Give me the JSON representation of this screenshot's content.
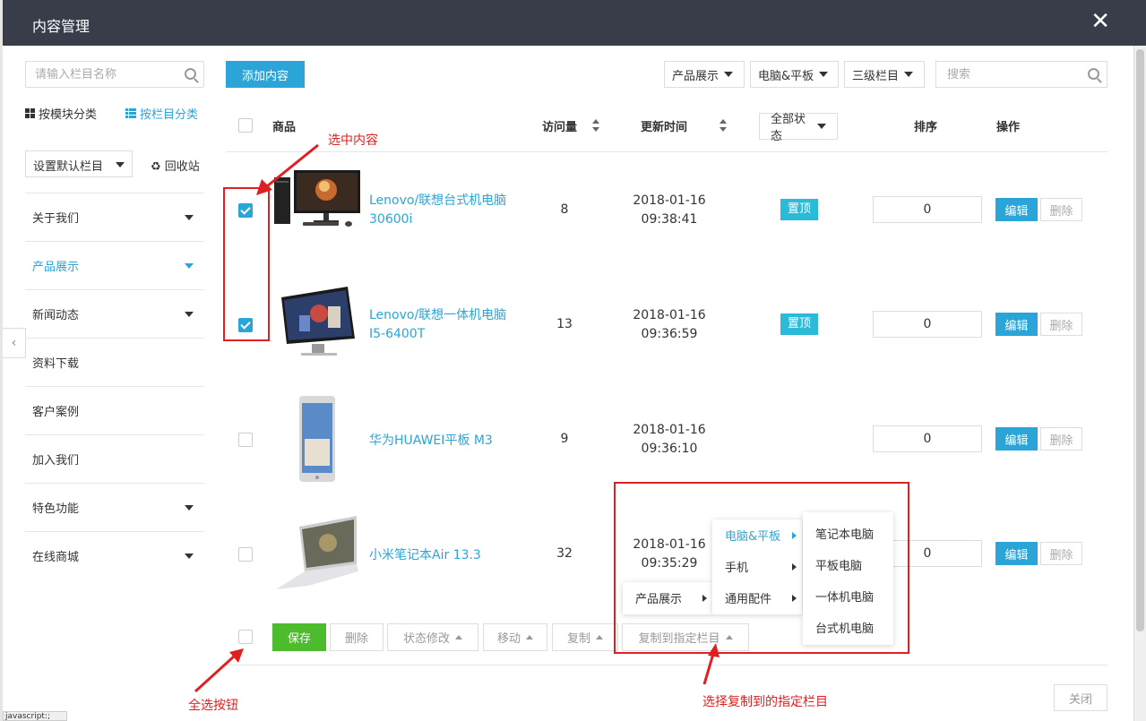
{
  "window": {
    "title": "内容管理",
    "close_icon": "close-icon"
  },
  "sidebar": {
    "search_placeholder": "请输入栏目名称",
    "by_module": "按模块分类",
    "by_column": "按栏目分类",
    "default_column": "设置默认栏目",
    "recycle": "♻ 回收站",
    "items": [
      {
        "label": "关于我们",
        "has_children": true
      },
      {
        "label": "产品展示",
        "has_children": true,
        "active": true
      },
      {
        "label": "新闻动态",
        "has_children": true
      },
      {
        "label": "资料下载",
        "has_children": false
      },
      {
        "label": "客户案例",
        "has_children": false
      },
      {
        "label": "加入我们",
        "has_children": false
      },
      {
        "label": "特色功能",
        "has_children": true
      },
      {
        "label": "在线商城",
        "has_children": true
      }
    ]
  },
  "toolbar": {
    "add": "添加内容",
    "filters": [
      "产品展示",
      "电脑&平板",
      "三级栏目"
    ],
    "search_placeholder": "搜索"
  },
  "table": {
    "headers": {
      "product": "商品",
      "visits": "访问量",
      "updated": "更新时间",
      "status": "全部状态",
      "sort": "排序",
      "ops": "操作"
    },
    "rows": [
      {
        "name": "Lenovo/联想台式机电脑 30600i",
        "visits": "8",
        "date": "2018-01-16",
        "time": "09:38:41",
        "top": "置顶",
        "sort": "0",
        "checked": true
      },
      {
        "name": "Lenovo/联想一体机电脑 I5-6400T",
        "visits": "13",
        "date": "2018-01-16",
        "time": "09:36:59",
        "top": "置顶",
        "sort": "0",
        "checked": true
      },
      {
        "name": "华为HUAWEI平板 M3",
        "visits": "9",
        "date": "2018-01-16",
        "time": "09:36:10",
        "top": "",
        "sort": "0",
        "checked": false
      },
      {
        "name": "小米笔记本Air 13.3",
        "visits": "32",
        "date": "2018-01-16",
        "time": "09:35:29",
        "top": "",
        "sort": "0",
        "checked": false
      }
    ],
    "edit": "编辑",
    "delete": "删除"
  },
  "bottom": {
    "save": "保存",
    "delete": "删除",
    "status": "状态修改",
    "move": "移动",
    "copy": "复制",
    "copy_to": "复制到指定栏目",
    "close": "关闭"
  },
  "menus": {
    "level1": [
      "产品展示"
    ],
    "level2": [
      "电脑&平板",
      "手机",
      "通用配件"
    ],
    "level3": [
      "笔记本电脑",
      "平板电脑",
      "一体机电脑",
      "台式机电脑"
    ]
  },
  "annotations": {
    "select_content": "选中内容",
    "select_all": "全选按钮",
    "copy_target": "选择复制到的指定栏目"
  },
  "status_text": "javascript:;",
  "colors": {
    "accent": "#2ba5d8",
    "save": "#4cbb2c",
    "annotation": "#e02020",
    "titlebar": "#393d49"
  }
}
